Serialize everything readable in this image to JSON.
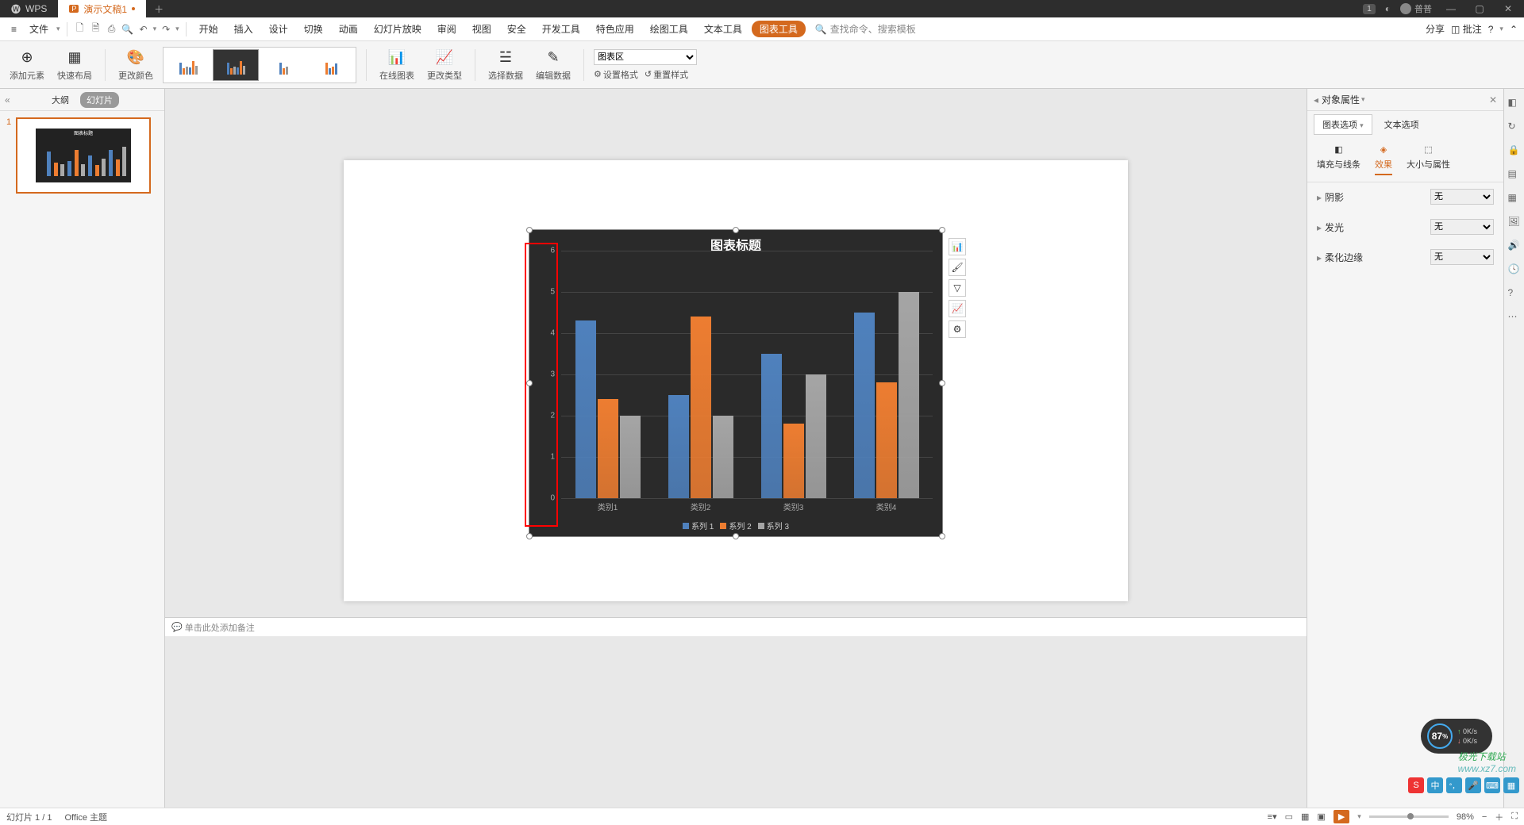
{
  "titlebar": {
    "app_name": "WPS",
    "doc_name": "演示文稿1",
    "user_name": "普普",
    "badge": "1"
  },
  "menubar": {
    "file": "文件",
    "items": [
      "开始",
      "插入",
      "设计",
      "切换",
      "动画",
      "幻灯片放映",
      "审阅",
      "视图",
      "安全",
      "开发工具",
      "特色应用",
      "绘图工具",
      "文本工具",
      "图表工具"
    ],
    "search_placeholder": "查找命令、搜索模板",
    "share": "分享",
    "comment": "批注"
  },
  "ribbon": {
    "add_element": "添加元素",
    "quick_layout": "快速布局",
    "change_color": "更改颜色",
    "online_chart": "在线图表",
    "change_type": "更改类型",
    "select_data": "选择数据",
    "edit_data": "编辑数据",
    "chart_area": "图表区",
    "set_format": "设置格式",
    "reset_style": "重置样式"
  },
  "slide_panel": {
    "outline": "大纲",
    "slides": "幻灯片",
    "slide_num": "1"
  },
  "chart_data": {
    "type": "bar",
    "title": "图表标题",
    "categories": [
      "类别1",
      "类别2",
      "类别3",
      "类别4"
    ],
    "series": [
      {
        "name": "系列 1",
        "values": [
          4.3,
          2.5,
          3.5,
          4.5
        ],
        "color": "#4f81bd"
      },
      {
        "name": "系列 2",
        "values": [
          2.4,
          4.4,
          1.8,
          2.8
        ],
        "color": "#ed7d31"
      },
      {
        "name": "系列 3",
        "values": [
          2.0,
          2.0,
          3.0,
          5.0
        ],
        "color": "#a5a5a5"
      }
    ],
    "ylim": [
      0,
      6
    ],
    "yticks": [
      0,
      1,
      2,
      3,
      4,
      5,
      6
    ]
  },
  "right_panel": {
    "title": "对象属性",
    "tab1": "图表选项",
    "tab2": "文本选项",
    "subtab1": "填充与线条",
    "subtab2": "效果",
    "subtab3": "大小与属性",
    "shadow": "阴影",
    "glow": "发光",
    "soft_edge": "柔化边缘",
    "none": "无"
  },
  "notes": {
    "placeholder": "单击此处添加备注"
  },
  "status": {
    "slide_info": "幻灯片 1 / 1",
    "theme": "Office 主题",
    "zoom": "98%"
  },
  "float": {
    "speed_pct": "87",
    "speed_unit": "%",
    "up": "0K/s",
    "down": "0K/s",
    "watermark": "www.xz7.com",
    "watermark2": "极光下载站"
  }
}
